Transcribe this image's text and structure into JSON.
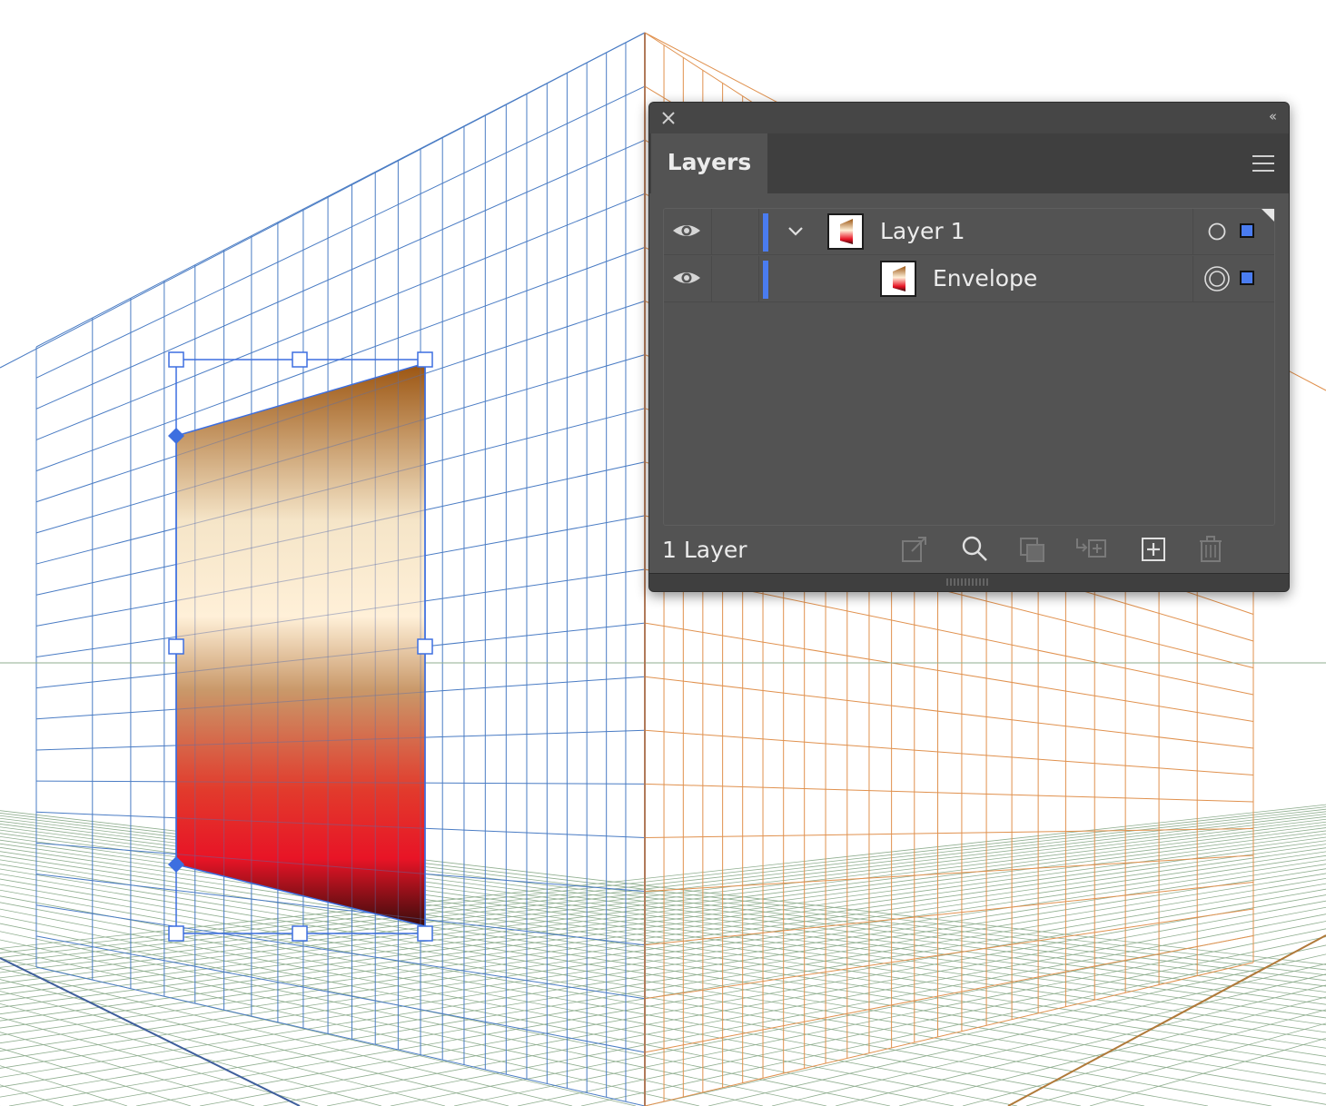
{
  "colors": {
    "left_grid": "#4a7cc4",
    "right_grid": "#e0914e",
    "floor_grid": "#8fae8f",
    "selection": "#3d6fe0",
    "panel_bg": "#535353",
    "layer_color": "#4a7cf0"
  },
  "artwork": {
    "gradient_stops": [
      "#9b5410",
      "#f5e5c8",
      "#fff0d8",
      "#c9996a",
      "#e23a2c",
      "#e81426",
      "#3a0c0c"
    ]
  },
  "layers_panel": {
    "close_icon": "close-icon",
    "collapse_label": "‹‹",
    "tab_label": "Layers",
    "menu_icon": "hamburger-menu-icon",
    "rows": [
      {
        "name": "Layer 1",
        "visible": true,
        "expanded": true,
        "target": "single-circle"
      },
      {
        "name": "Envelope",
        "visible": true,
        "target": "double-circle"
      }
    ],
    "footer_count": "1 Layer",
    "footer_icons": [
      "export-icon",
      "search-icon",
      "clipping-mask-icon",
      "move-to-layer-icon",
      "new-layer-icon",
      "trash-icon"
    ]
  }
}
